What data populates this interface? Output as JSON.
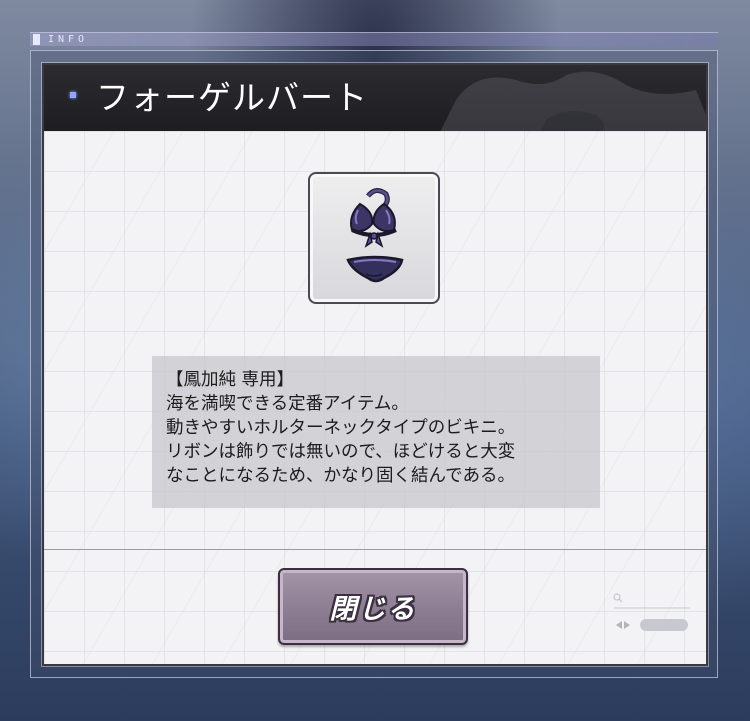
{
  "header": {
    "label": "INFO"
  },
  "dialog": {
    "title": "フォーゲルバート",
    "item": {
      "icon": "bikini-swimsuit-icon"
    },
    "description": [
      "【鳳加純 専用】",
      "海を満喫できる定番アイテム。",
      "動きやすいホルターネックタイプのビキニ。",
      "リボンは飾りでは無いので、ほどけると大変",
      "なことになるため、かなり固く結んである。"
    ],
    "close_label": "閉じる"
  },
  "colors": {
    "title_bar": "#1d1d22",
    "button": "#8f7f94",
    "item_accent": "#3a3266"
  }
}
